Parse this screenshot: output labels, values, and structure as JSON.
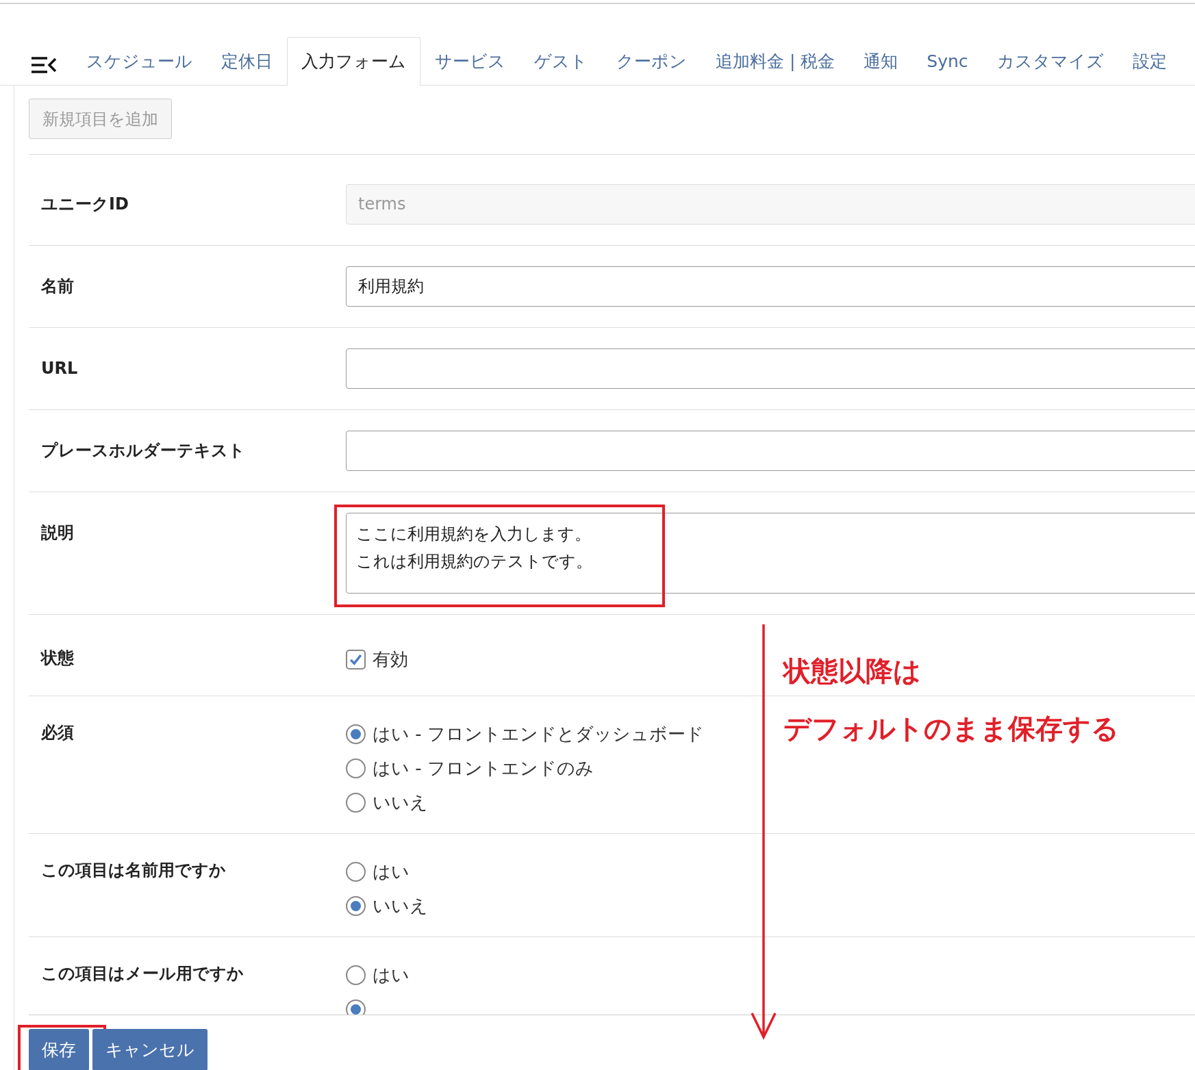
{
  "tabs": [
    {
      "label": "スケジュール",
      "selected": false
    },
    {
      "label": "定休日",
      "selected": false
    },
    {
      "label": "入力フォーム",
      "selected": true
    },
    {
      "label": "サービス",
      "selected": false
    },
    {
      "label": "ゲスト",
      "selected": false
    },
    {
      "label": "クーポン",
      "selected": false
    },
    {
      "label": "追加料金 | 税金",
      "selected": false
    },
    {
      "label": "通知",
      "selected": false
    },
    {
      "label": "Sync",
      "selected": false
    },
    {
      "label": "カスタマイズ",
      "selected": false
    },
    {
      "label": "設定",
      "selected": false
    }
  ],
  "add_button": {
    "label": "新規項目を追加",
    "disabled": true
  },
  "fields": [
    {
      "kind": "text",
      "label": "ユニークID",
      "value": "terms",
      "disabled": true
    },
    {
      "kind": "text",
      "label": "名前",
      "value": "利用規約",
      "disabled": false
    },
    {
      "kind": "text",
      "label": "URL",
      "disabled": false
    },
    {
      "kind": "text",
      "label": "プレースホルダーテキスト",
      "disabled": false
    },
    {
      "kind": "textarea",
      "label": "説明",
      "lines": [
        "ここに利用規約を入力します。",
        "これは利用規約のテストです。"
      ],
      "highlighted": true
    },
    {
      "kind": "checkbox",
      "label": "状態",
      "option": "有効",
      "checked": true
    },
    {
      "kind": "radio",
      "label": "必須",
      "options": [
        {
          "label": "はい - フロントエンドとダッシュボード",
          "selected": true
        },
        {
          "label": "はい - フロントエンドのみ",
          "selected": false
        },
        {
          "label": "いいえ",
          "selected": false
        }
      ]
    },
    {
      "kind": "radio",
      "label": "この項目は名前用ですか",
      "options": [
        {
          "label": "はい",
          "selected": false
        },
        {
          "label": "いいえ",
          "selected": true
        }
      ]
    },
    {
      "kind": "radio",
      "label": "この項目はメール用ですか",
      "options": [
        {
          "label": "はい",
          "selected": false
        },
        {
          "selected": true
        }
      ]
    }
  ],
  "buttons": [
    {
      "label": "保存",
      "highlighted": true
    },
    {
      "label": "キャンセル",
      "highlighted": false
    }
  ],
  "annotation": {
    "lines": [
      "状態以降は",
      "デフォルトのまま保存する"
    ]
  }
}
